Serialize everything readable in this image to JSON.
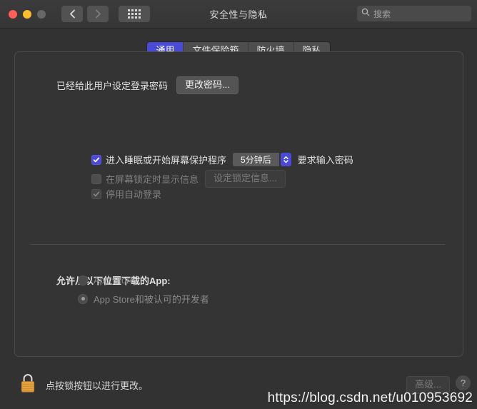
{
  "window": {
    "title": "安全性与隐私",
    "traffic_lights": [
      "close",
      "minimize",
      "zoom"
    ],
    "nav": {
      "back_icon": "chevron-left-icon",
      "forward_icon": "chevron-right-icon",
      "show_all_icon": "grid-icon"
    },
    "search": {
      "placeholder": "搜索",
      "icon": "search-icon",
      "value": ""
    }
  },
  "tabs": [
    {
      "label": "通用",
      "active": true
    },
    {
      "label": "文件保险箱",
      "active": false
    },
    {
      "label": "防火墙",
      "active": false
    },
    {
      "label": "隐私",
      "active": false
    }
  ],
  "general": {
    "password_status": "已经给此用户设定登录密码",
    "change_password_button": "更改密码...",
    "require_password": {
      "prefix": "进入睡眠或开始屏幕保护程序",
      "interval": "5分钟后",
      "suffix": "要求输入密码",
      "checked": true,
      "enabled": true
    },
    "lock_message": {
      "label": "在屏幕锁定时显示信息",
      "button": "设定锁定信息...",
      "checked": false,
      "enabled": false
    },
    "disable_auto_login": {
      "label": "停用自动登录",
      "checked": true,
      "enabled": false
    },
    "download_section": {
      "heading": "允许从以下位置下载的App:",
      "options": [
        {
          "label": "App Store",
          "selected": false
        },
        {
          "label": "App Store和被认可的开发者",
          "selected": true
        }
      ],
      "enabled": false
    }
  },
  "footer": {
    "lock_icon": "lock-closed-icon",
    "lock_message": "点按锁按钮以进行更改。",
    "advanced_button": "高级...",
    "help_button": "?"
  },
  "watermark": "https://blog.csdn.net/u010953692",
  "colors": {
    "accent": "#4a4ad6",
    "window_bg": "#323232",
    "panel_bg": "#343434",
    "lock_body": "#e8a33d",
    "traffic_red": "#ff5f57",
    "traffic_yellow": "#febc2e",
    "traffic_gray": "#676767"
  }
}
